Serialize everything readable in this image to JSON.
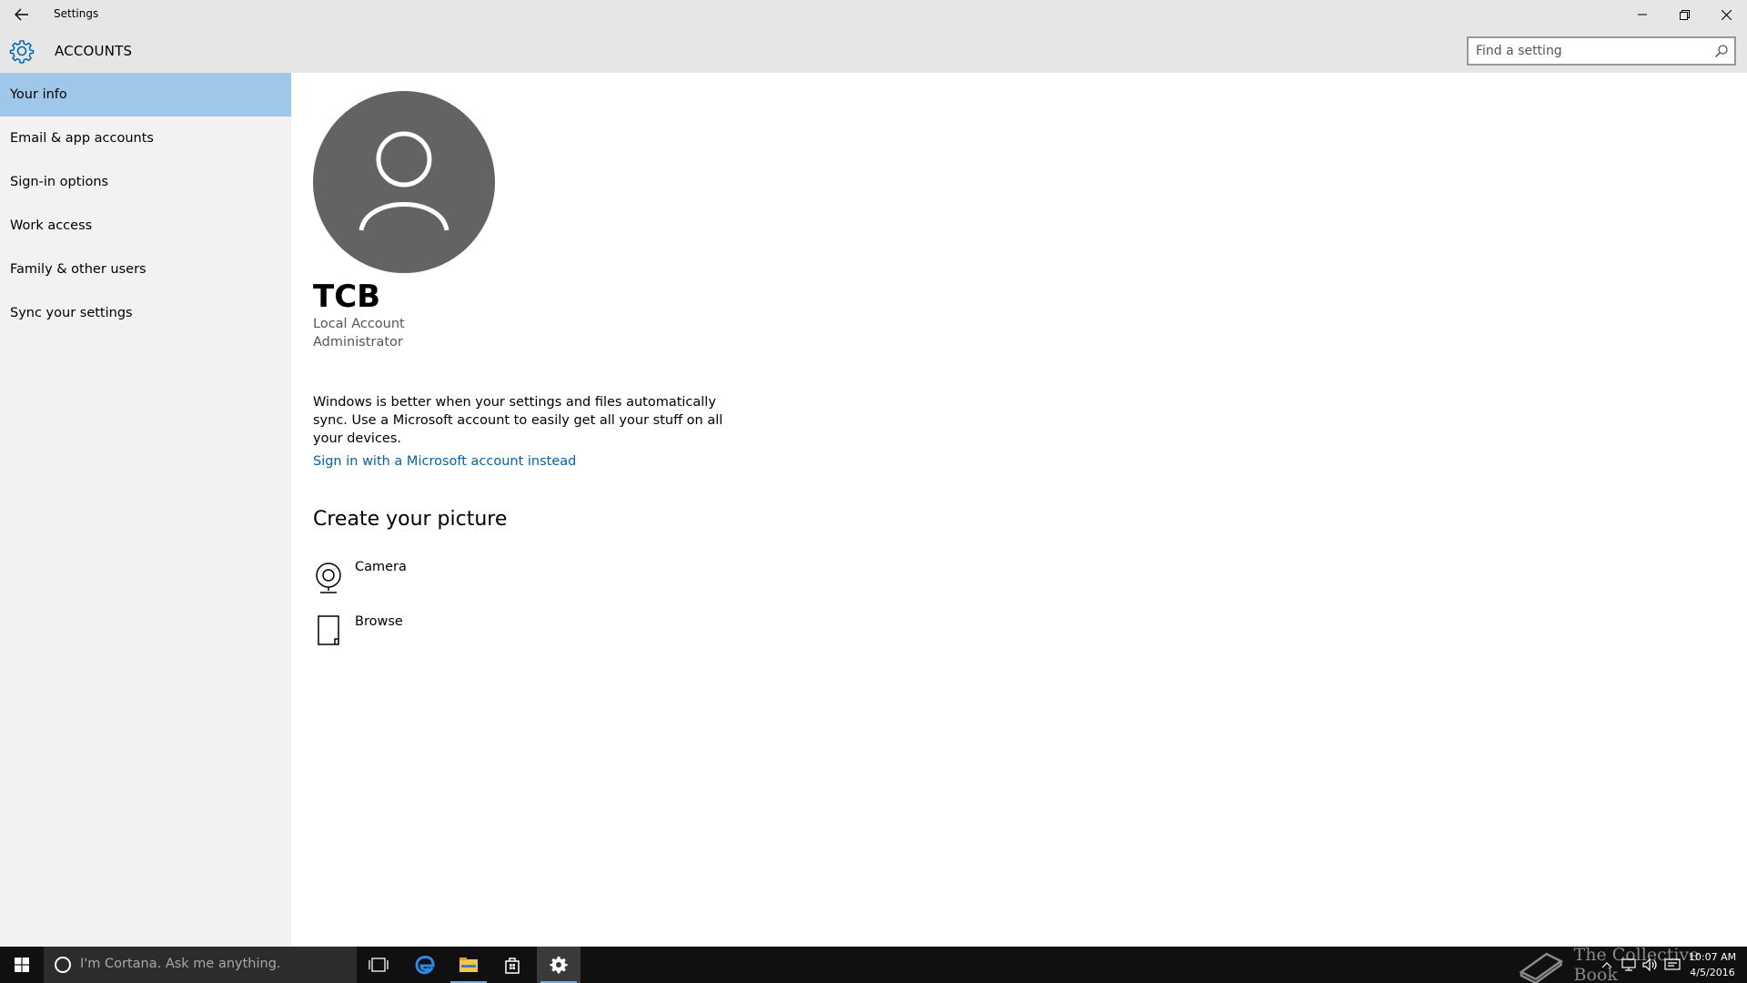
{
  "window": {
    "title": "Settings",
    "icons": {
      "back": "arrow-left-icon",
      "minimize": "minimize-icon",
      "maximize": "restore-icon",
      "close": "close-icon"
    }
  },
  "header": {
    "title": "ACCOUNTS",
    "icon": "gear-icon",
    "search": {
      "placeholder": "Find a setting",
      "value": "",
      "icon": "search-icon"
    }
  },
  "sidebar": {
    "items": [
      {
        "label": "Your info",
        "active": true
      },
      {
        "label": "Email & app accounts",
        "active": false
      },
      {
        "label": "Sign-in options",
        "active": false
      },
      {
        "label": "Work access",
        "active": false
      },
      {
        "label": "Family & other users",
        "active": false
      },
      {
        "label": "Sync your settings",
        "active": false
      }
    ]
  },
  "main": {
    "avatar_icon": "person-icon",
    "user_name": "TCB",
    "account_type": "Local Account",
    "account_role": "Administrator",
    "sync_message": "Windows is better when your settings and files automatically sync. Use a Microsoft account to easily get all your stuff on all your devices.",
    "ms_link": "Sign in with a Microsoft account instead",
    "picture_section_title": "Create your picture",
    "picture_options": [
      {
        "label": "Camera",
        "icon": "webcam-icon"
      },
      {
        "label": "Browse",
        "icon": "document-icon"
      }
    ]
  },
  "taskbar": {
    "cortana_placeholder": "I'm Cortana. Ask me anything.",
    "apps": [
      "task-view-icon",
      "edge-icon",
      "file-explorer-icon",
      "store-icon",
      "settings-gear-icon"
    ],
    "watermark": "The Collective Book",
    "clock": {
      "time": "10:07 AM",
      "date": "4/5/2016"
    },
    "colors": {
      "background": "#101010",
      "accent": "#7aa7d8"
    }
  },
  "colors": {
    "selected_nav": "#9fc7ea",
    "link": "#0063b1",
    "sidebar_bg": "#f2f2f2",
    "header_bg": "#e6e6e6",
    "avatar_bg": "#636363"
  }
}
